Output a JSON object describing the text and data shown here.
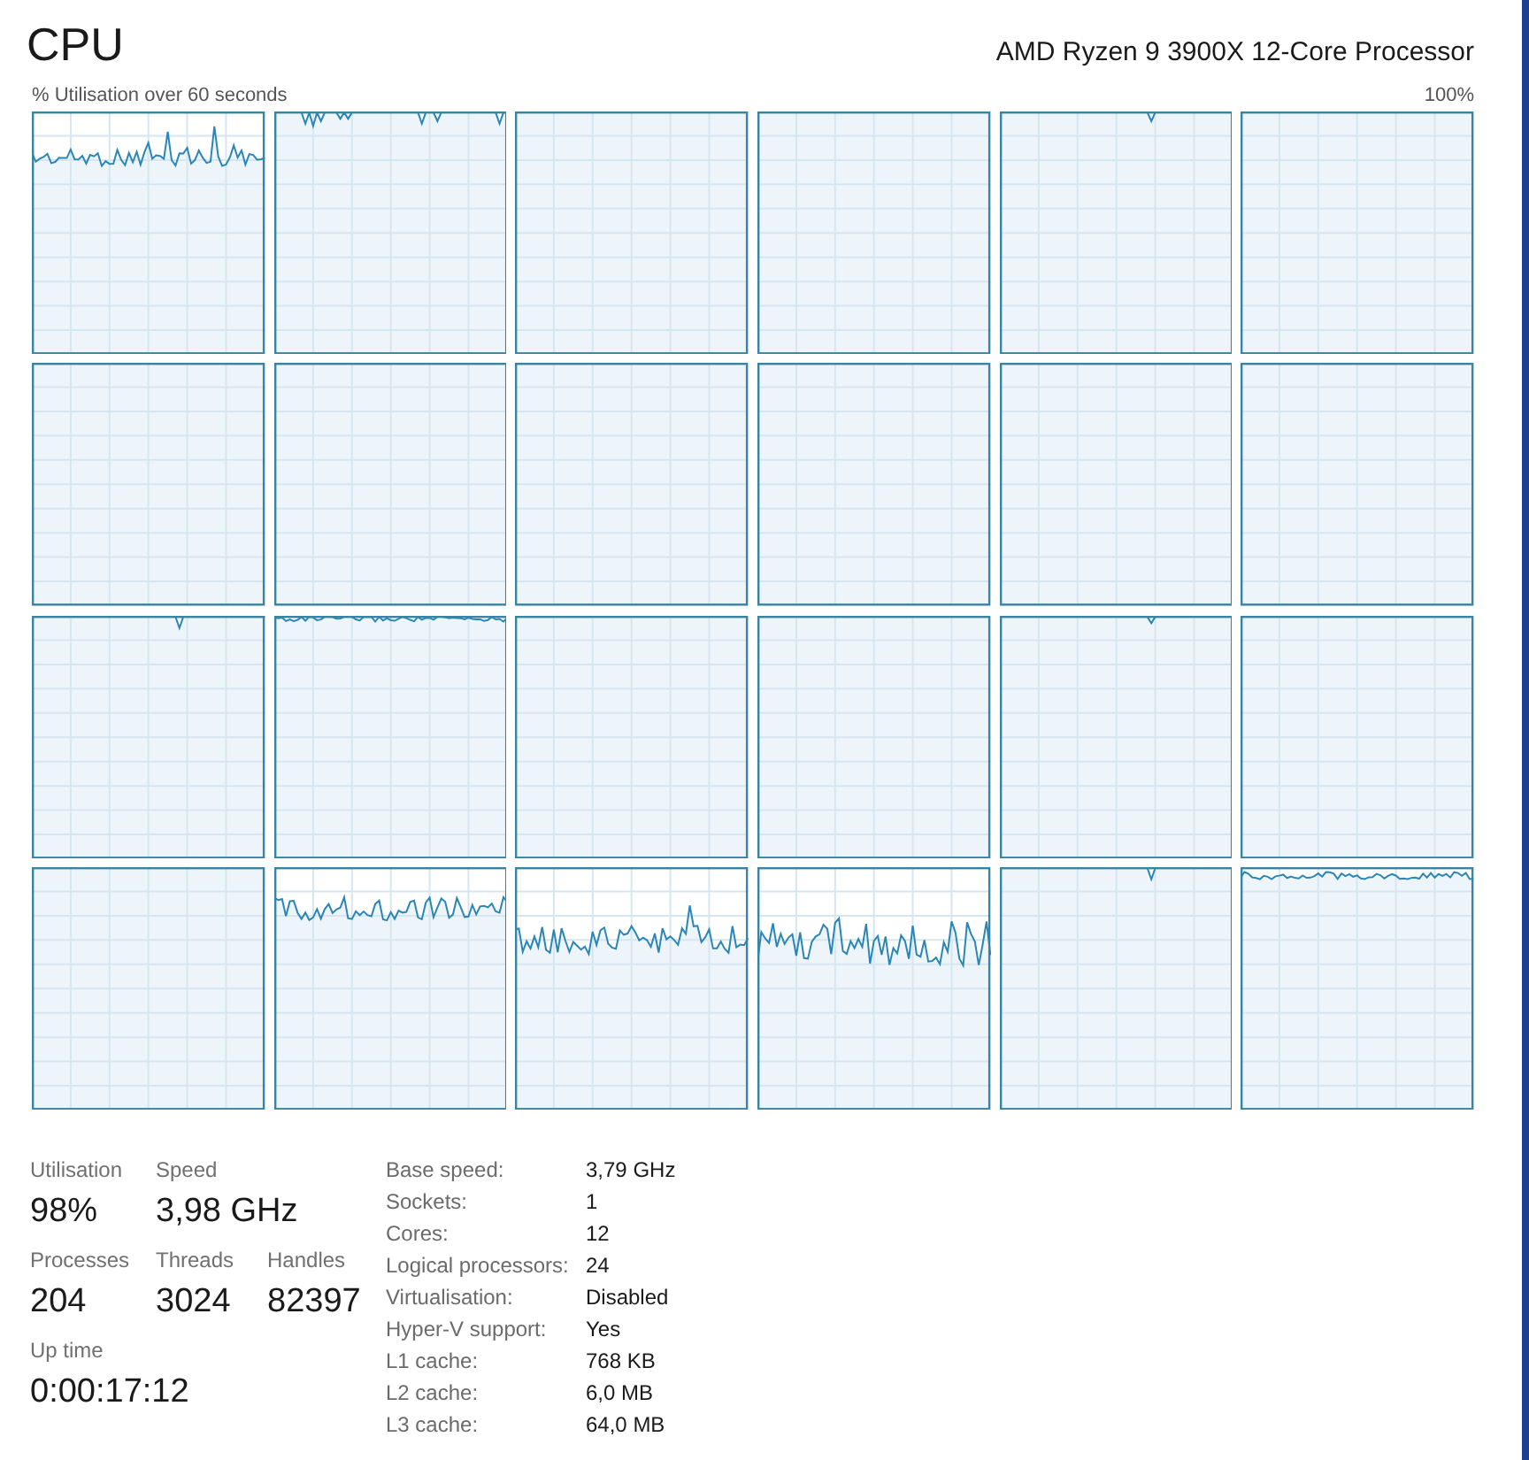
{
  "header": {
    "title": "CPU",
    "processor": "AMD Ryzen 9 3900X 12-Core Processor"
  },
  "graph_panel": {
    "caption": "% Utilisation over 60 seconds",
    "scale_max": "100%"
  },
  "stat_rows": [
    [
      {
        "label": "Utilisation",
        "value": "98%"
      },
      {
        "label": "Speed",
        "value": "3,98 GHz"
      }
    ],
    [
      {
        "label": "Processes",
        "value": "204"
      },
      {
        "label": "Threads",
        "value": "3024"
      },
      {
        "label": "Handles",
        "value": "82397"
      }
    ],
    [
      {
        "label": "Up time",
        "value": "0:00:17:12"
      }
    ]
  ],
  "details": [
    {
      "label": "Base speed:",
      "value": "3,79 GHz"
    },
    {
      "label": "Sockets:",
      "value": "1"
    },
    {
      "label": "Cores:",
      "value": "12"
    },
    {
      "label": "Logical processors:",
      "value": "24"
    },
    {
      "label": "Virtualisation:",
      "value": "Disabled"
    },
    {
      "label": "Hyper-V support:",
      "value": "Yes"
    },
    {
      "label": "L1 cache:",
      "value": "768 KB"
    },
    {
      "label": "L2 cache:",
      "value": "6,0 MB"
    },
    {
      "label": "L3 cache:",
      "value": "64,0 MB"
    }
  ]
}
